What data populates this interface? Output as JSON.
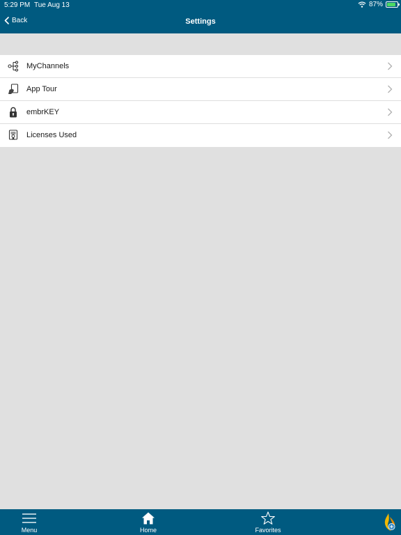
{
  "status_bar": {
    "time": "5:29 PM",
    "date": "Tue Aug 13",
    "battery_percent": "87%",
    "battery_level": 0.87
  },
  "nav": {
    "back_label": "Back",
    "title": "Settings"
  },
  "settings": {
    "items": [
      {
        "label": "MyChannels",
        "icon": "channels-icon"
      },
      {
        "label": "App Tour",
        "icon": "tour-icon"
      },
      {
        "label": "embrKEY",
        "icon": "lock-icon"
      },
      {
        "label": "Licenses Used",
        "icon": "certificate-icon"
      }
    ]
  },
  "tabs": {
    "menu_label": "Menu",
    "home_label": "Home",
    "favorites_label": "Favorites"
  },
  "colors": {
    "header": "#005a80",
    "background": "#e0e0e0",
    "list_background": "#ffffff",
    "battery": "#4cd964"
  }
}
